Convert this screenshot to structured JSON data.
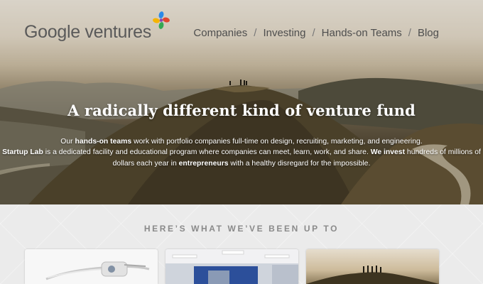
{
  "brand": {
    "name": "Google ventures",
    "mark_colors": [
      "#2b8ae8",
      "#e2462f",
      "#f5b400",
      "#34a853",
      "#8e44ad"
    ]
  },
  "nav": {
    "items": [
      {
        "label": "Companies"
      },
      {
        "label": "Investing"
      },
      {
        "label": "Hands-on Teams"
      },
      {
        "label": "Blog"
      }
    ],
    "separator": "/"
  },
  "hero": {
    "headline": "A radically different kind of venture fund",
    "intro": [
      {
        "text": "Our ",
        "bold": false
      },
      {
        "text": "hands-on teams",
        "bold": true
      },
      {
        "text": " work with portfolio companies full-time on design, recruiting, marketing, and engineering. ",
        "bold": false
      },
      {
        "text": "Startup Lab",
        "bold": true
      },
      {
        "text": " is a dedicated facility and educational program where companies can meet, learn, work, and share. ",
        "bold": false
      },
      {
        "text": "We invest",
        "bold": true
      },
      {
        "text": " hundreds of millions of dollars each year in ",
        "bold": false
      },
      {
        "text": "entrepreneurs",
        "bold": true
      },
      {
        "text": " with a healthy disregard for the impossible.",
        "bold": false
      }
    ]
  },
  "updates": {
    "title": "HERE’S WHAT WE’VE BEEN UP TO",
    "cards": [
      {
        "image": "glass-headset-image"
      },
      {
        "image": "office-interior-image"
      },
      {
        "image": "hilltop-people-image"
      }
    ]
  }
}
